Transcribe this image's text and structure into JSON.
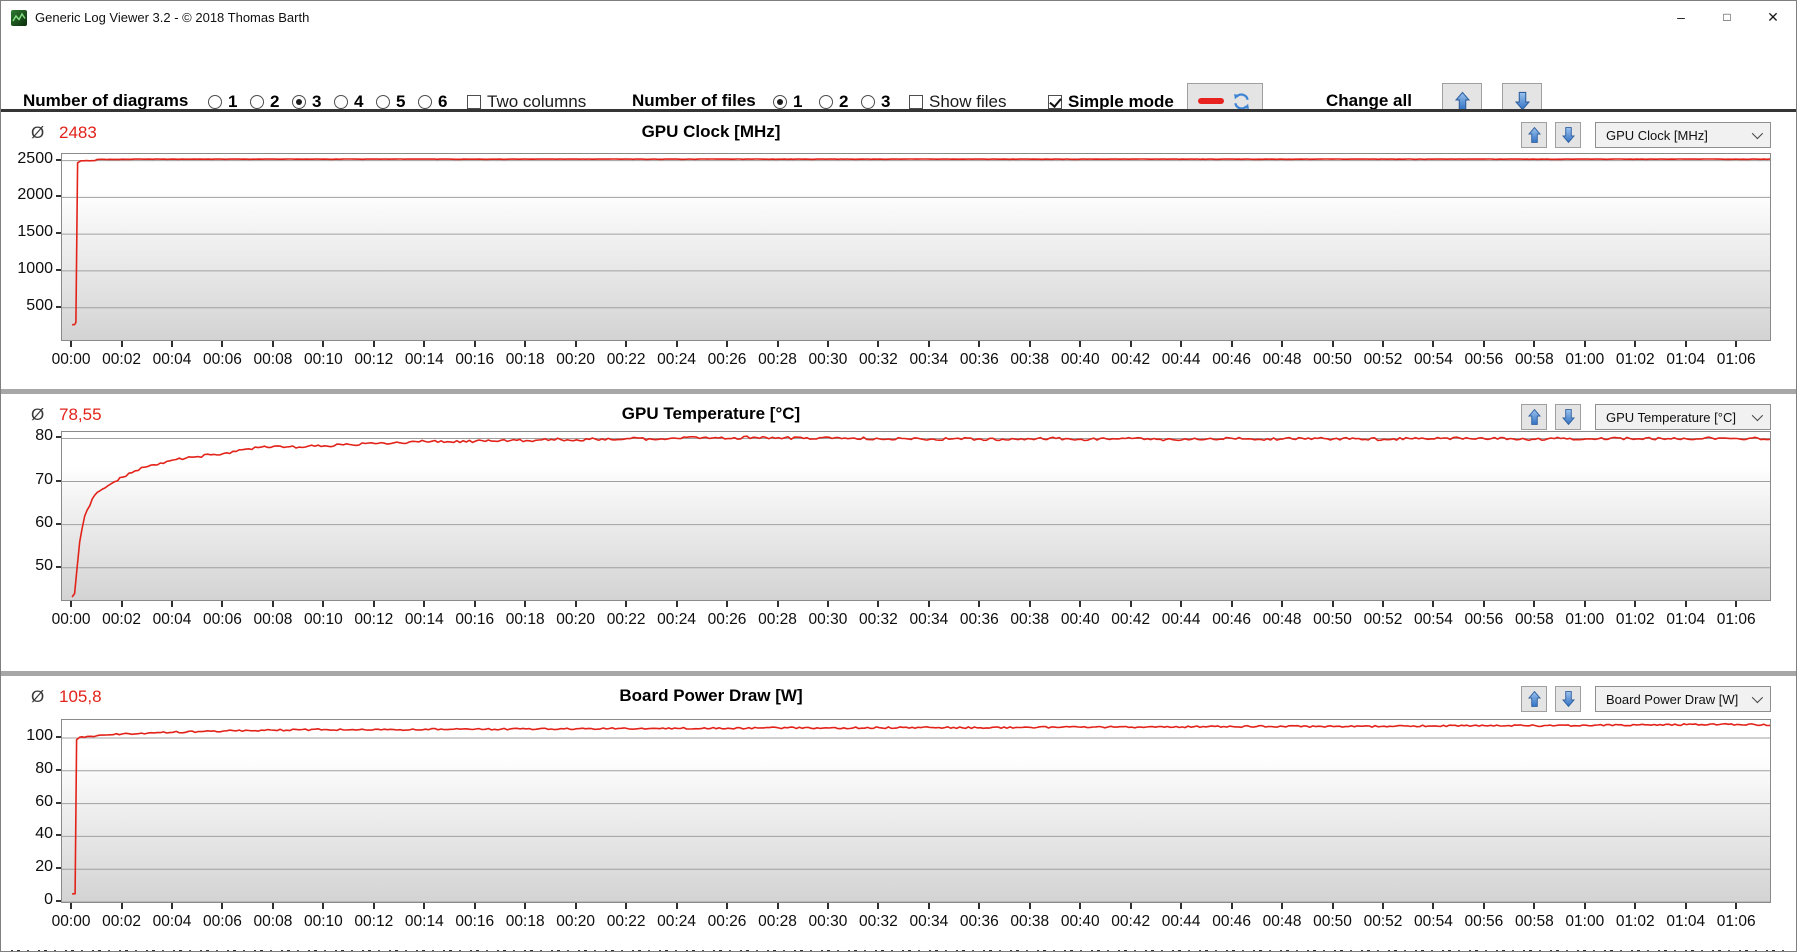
{
  "window": {
    "title": "Generic Log Viewer 3.2 - © 2018 Thomas Barth",
    "controls": {
      "minimize": "–",
      "maximize": "□",
      "close": "✕"
    }
  },
  "toolbar": {
    "number_of_diagrams": {
      "label": "Number of diagrams",
      "options": [
        "1",
        "2",
        "3",
        "4",
        "5",
        "6"
      ],
      "selected": "3"
    },
    "two_columns": {
      "label": "Two columns",
      "checked": false
    },
    "number_of_files": {
      "label": "Number of files",
      "options": [
        "1",
        "2",
        "3"
      ],
      "selected": "1"
    },
    "show_files": {
      "label": "Show files",
      "checked": false
    },
    "simple_mode": {
      "label": "Simple mode",
      "checked": true
    },
    "line_style_refresh_button": {
      "icons": [
        "red-line-icon",
        "refresh-icon"
      ]
    },
    "change_all": {
      "label": "Change all",
      "buttons": [
        "up-arrow",
        "down-arrow"
      ]
    }
  },
  "chart_data": [
    {
      "type": "line",
      "title": "GPU Clock [MHz]",
      "average_symbol": "Ø",
      "average": "2483",
      "selector_value": "GPU Clock [MHz]",
      "line_color": "#e2231a",
      "grid": true,
      "legend": "none",
      "xlabel": "",
      "ylabel": "",
      "x_range_minutes": [
        -0.4,
        67.3
      ],
      "ylim": [
        60,
        2590
      ],
      "y_tick_values": [
        2500,
        2000,
        1500,
        1000,
        500
      ],
      "y_tick_labels": [
        "2500",
        "2000",
        "1500",
        "1000",
        "500"
      ],
      "x_tick_labels": [
        "00:00",
        "00:02",
        "00:04",
        "00:06",
        "00:08",
        "00:10",
        "00:12",
        "00:14",
        "00:16",
        "00:18",
        "00:20",
        "00:22",
        "00:24",
        "00:26",
        "00:28",
        "00:30",
        "00:32",
        "00:34",
        "00:36",
        "00:38",
        "00:40",
        "00:42",
        "00:44",
        "00:46",
        "00:48",
        "00:50",
        "00:52",
        "00:54",
        "00:56",
        "00:58",
        "01:00",
        "01:02",
        "01:04",
        "01:06"
      ],
      "series": [
        {
          "name": "GPU Clock",
          "jitter": 2,
          "points": [
            [
              0,
              268
            ],
            [
              0.1,
              270
            ],
            [
              0.15,
              300
            ],
            [
              0.22,
              2470
            ],
            [
              0.35,
              2497
            ],
            [
              0.9,
              2500
            ],
            [
              1,
              2516
            ],
            [
              2,
              2519
            ],
            [
              4,
              2520
            ],
            [
              6,
              2519
            ],
            [
              8,
              2521
            ],
            [
              10,
              2520
            ],
            [
              12,
              2520
            ],
            [
              14,
              2521
            ],
            [
              16,
              2519
            ],
            [
              18,
              2520
            ],
            [
              20,
              2521
            ],
            [
              22,
              2520
            ],
            [
              24,
              2520
            ],
            [
              26,
              2521
            ],
            [
              28,
              2519
            ],
            [
              30,
              2520
            ],
            [
              32,
              2520
            ],
            [
              34,
              2521
            ],
            [
              36,
              2520
            ],
            [
              38,
              2519
            ],
            [
              40,
              2520
            ],
            [
              42,
              2521
            ],
            [
              44,
              2520
            ],
            [
              46,
              2520
            ],
            [
              48,
              2519
            ],
            [
              50,
              2521
            ],
            [
              52,
              2520
            ],
            [
              54,
              2520
            ],
            [
              56,
              2521
            ],
            [
              58,
              2519
            ],
            [
              60,
              2520
            ],
            [
              62,
              2520
            ],
            [
              64,
              2521
            ],
            [
              66,
              2519
            ],
            [
              67.4,
              2520
            ]
          ]
        }
      ]
    },
    {
      "type": "line",
      "title": "GPU Temperature [°C]",
      "average_symbol": "Ø",
      "average": "78,55",
      "selector_value": "GPU Temperature [°C]",
      "line_color": "#e2231a",
      "grid": true,
      "legend": "none",
      "xlabel": "",
      "ylabel": "",
      "x_range_minutes": [
        -0.4,
        67.3
      ],
      "ylim": [
        42.5,
        81.5
      ],
      "y_tick_values": [
        80,
        70,
        60,
        50
      ],
      "y_tick_labels": [
        "80",
        "70",
        "60",
        "50"
      ],
      "x_tick_labels": [
        "00:00",
        "00:02",
        "00:04",
        "00:06",
        "00:08",
        "00:10",
        "00:12",
        "00:14",
        "00:16",
        "00:18",
        "00:20",
        "00:22",
        "00:24",
        "00:26",
        "00:28",
        "00:30",
        "00:32",
        "00:34",
        "00:36",
        "00:38",
        "00:40",
        "00:42",
        "00:44",
        "00:46",
        "00:48",
        "00:50",
        "00:52",
        "00:54",
        "00:56",
        "00:58",
        "01:00",
        "01:02",
        "01:04",
        "01:06"
      ],
      "series": [
        {
          "name": "GPU Temperature",
          "jitter": 0.3,
          "points": [
            [
              0,
              43.2
            ],
            [
              0.1,
              44
            ],
            [
              0.2,
              50
            ],
            [
              0.3,
              56
            ],
            [
              0.5,
              62
            ],
            [
              0.8,
              66
            ],
            [
              1,
              67.5
            ],
            [
              1.3,
              68.5
            ],
            [
              1.7,
              70
            ],
            [
              2,
              71
            ],
            [
              2.5,
              72.5
            ],
            [
              3,
              73.5
            ],
            [
              3.5,
              74.3
            ],
            [
              4,
              75
            ],
            [
              4.5,
              75.4
            ],
            [
              5,
              75.8
            ],
            [
              5.5,
              76.2
            ],
            [
              6,
              76.5
            ],
            [
              6.5,
              77
            ],
            [
              7,
              77.6
            ],
            [
              7.5,
              78
            ],
            [
              8,
              78.2
            ],
            [
              9,
              78
            ],
            [
              10,
              78.3
            ],
            [
              11,
              78.6
            ],
            [
              12,
              78.8
            ],
            [
              13,
              79
            ],
            [
              14,
              79.3
            ],
            [
              15,
              79.2
            ],
            [
              16,
              79.4
            ],
            [
              17,
              79.6
            ],
            [
              18,
              79.5
            ],
            [
              19,
              79.8
            ],
            [
              20,
              79.7
            ],
            [
              21,
              79.9
            ],
            [
              22,
              80
            ],
            [
              23,
              79.8
            ],
            [
              24,
              80
            ],
            [
              25,
              80.2
            ],
            [
              26,
              80
            ],
            [
              27,
              80.3
            ],
            [
              28,
              80.2
            ],
            [
              29,
              80
            ],
            [
              30,
              80.3
            ],
            [
              31,
              80.1
            ],
            [
              32,
              79.9
            ],
            [
              33,
              80
            ],
            [
              34,
              79.8
            ],
            [
              35,
              80
            ],
            [
              36,
              79.9
            ],
            [
              37,
              79.7
            ],
            [
              38,
              79.9
            ],
            [
              39,
              80
            ],
            [
              40,
              79.8
            ],
            [
              41,
              79.9
            ],
            [
              42,
              80
            ],
            [
              43,
              79.8
            ],
            [
              44,
              79.7
            ],
            [
              45,
              79.9
            ],
            [
              46,
              80
            ],
            [
              47,
              79.8
            ],
            [
              48,
              79.9
            ],
            [
              49,
              80.1
            ],
            [
              50,
              79.9
            ],
            [
              51,
              80
            ],
            [
              52,
              79.8
            ],
            [
              53,
              80
            ],
            [
              54,
              79.9
            ],
            [
              55,
              80.1
            ],
            [
              56,
              79.9
            ],
            [
              57,
              80
            ],
            [
              58,
              79.8
            ],
            [
              59,
              80
            ],
            [
              60,
              79.9
            ],
            [
              61,
              80.1
            ],
            [
              62,
              79.9
            ],
            [
              63,
              80
            ],
            [
              64,
              79.9
            ],
            [
              65,
              80.1
            ],
            [
              66,
              80
            ],
            [
              67.4,
              80
            ]
          ]
        }
      ]
    },
    {
      "type": "line",
      "title": "Board Power Draw [W]",
      "average_symbol": "Ø",
      "average": "105,8",
      "selector_value": "Board Power Draw [W]",
      "line_color": "#e2231a",
      "grid": true,
      "legend": "none",
      "xlabel": "",
      "ylabel": "",
      "x_range_minutes": [
        -0.4,
        67.3
      ],
      "ylim": [
        0,
        111
      ],
      "y_tick_values": [
        100,
        80,
        60,
        40,
        20,
        0
      ],
      "y_tick_labels": [
        "100",
        "80",
        "60",
        "40",
        "20",
        "0"
      ],
      "x_tick_labels": [
        "00:00",
        "00:02",
        "00:04",
        "00:06",
        "00:08",
        "00:10",
        "00:12",
        "00:14",
        "00:16",
        "00:18",
        "00:20",
        "00:22",
        "00:24",
        "00:26",
        "00:28",
        "00:30",
        "00:32",
        "00:34",
        "00:36",
        "00:38",
        "00:40",
        "00:42",
        "00:44",
        "00:46",
        "00:48",
        "00:50",
        "00:52",
        "00:54",
        "00:56",
        "00:58",
        "01:00",
        "01:02",
        "01:04",
        "01:06"
      ],
      "series": [
        {
          "name": "Board Power Draw",
          "jitter": 0.5,
          "points": [
            [
              0,
              5
            ],
            [
              0.12,
              5
            ],
            [
              0.18,
              99
            ],
            [
              0.3,
              100.5
            ],
            [
              0.6,
              101
            ],
            [
              1,
              101.5
            ],
            [
              1.5,
              102
            ],
            [
              2,
              102.5
            ],
            [
              3,
              103
            ],
            [
              4,
              103.5
            ],
            [
              5,
              104
            ],
            [
              6,
              104.3
            ],
            [
              7,
              104.6
            ],
            [
              8,
              104.8
            ],
            [
              9,
              105
            ],
            [
              10,
              105.2
            ],
            [
              11,
              105
            ],
            [
              12,
              105.3
            ],
            [
              13,
              105.1
            ],
            [
              14,
              105.4
            ],
            [
              15,
              105.3
            ],
            [
              16,
              105.5
            ],
            [
              17,
              105.4
            ],
            [
              18,
              105.6
            ],
            [
              19,
              105.5
            ],
            [
              20,
              105.7
            ],
            [
              22,
              105.8
            ],
            [
              24,
              105.9
            ],
            [
              26,
              106
            ],
            [
              28,
              106.2
            ],
            [
              30,
              106.1
            ],
            [
              32,
              106.3
            ],
            [
              34,
              106.4
            ],
            [
              36,
              106.3
            ],
            [
              38,
              106.5
            ],
            [
              40,
              106.6
            ],
            [
              42,
              106.7
            ],
            [
              44,
              106.8
            ],
            [
              46,
              107
            ],
            [
              48,
              107.1
            ],
            [
              50,
              107
            ],
            [
              52,
              107.2
            ],
            [
              54,
              107.4
            ],
            [
              56,
              107.5
            ],
            [
              58,
              107.6
            ],
            [
              60,
              107.8
            ],
            [
              62,
              108
            ],
            [
              64,
              108.2
            ],
            [
              66,
              108.3
            ],
            [
              67.4,
              108
            ]
          ]
        }
      ]
    }
  ]
}
